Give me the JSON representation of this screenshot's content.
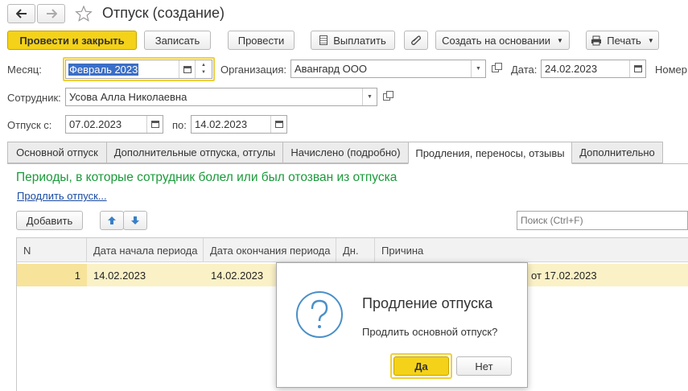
{
  "window": {
    "title": "Отпуск (создание)"
  },
  "toolbar": {
    "post_close": "Провести и закрыть",
    "save": "Записать",
    "post": "Провести",
    "pay": "Выплатить",
    "create_based": "Создать на основании",
    "print": "Печать"
  },
  "form": {
    "month_label": "Месяц:",
    "month_value": "Февраль 2023",
    "org_label": "Организация:",
    "org_value": "Авангард ООО",
    "date_label": "Дата:",
    "date_value": "24.02.2023",
    "number_label": "Номер:",
    "employee_label": "Сотрудник:",
    "employee_value": "Усова Алла Николаевна",
    "vac_from_label": "Отпуск с:",
    "vac_from_value": "07.02.2023",
    "vac_to_label": "по:",
    "vac_to_value": "14.02.2023"
  },
  "tabs": [
    {
      "label": "Основной отпуск"
    },
    {
      "label": "Дополнительные отпуска, отгулы"
    },
    {
      "label": "Начислено (подробно)"
    },
    {
      "label": "Продления, переносы, отзывы",
      "active": true
    },
    {
      "label": "Дополнительно"
    }
  ],
  "panel": {
    "heading": "Периоды, в которые сотрудник болел или был отозван из отпуска",
    "extend_link": "Продлить отпуск...",
    "add_button": "Добавить",
    "search_placeholder": "Поиск (Ctrl+F)"
  },
  "table": {
    "columns": [
      "N",
      "Дата начала периода",
      "Дата окончания периода",
      "Дн.",
      "Причина"
    ],
    "rows": [
      {
        "n": "1",
        "start": "14.02.2023",
        "end": "14.02.2023",
        "days": "",
        "reason": "от 17.02.2023"
      }
    ]
  },
  "dialog": {
    "title": "Продление отпуска",
    "message": "Продлить основной отпуск?",
    "yes": "Да",
    "no": "Нет"
  },
  "colors": {
    "accent_yellow": "#f4d21a",
    "heading_green": "#1a9a3a",
    "link_blue": "#1a4aa0",
    "row_selected": "#fbf1c6",
    "dialog_icon": "#4a90c8"
  }
}
